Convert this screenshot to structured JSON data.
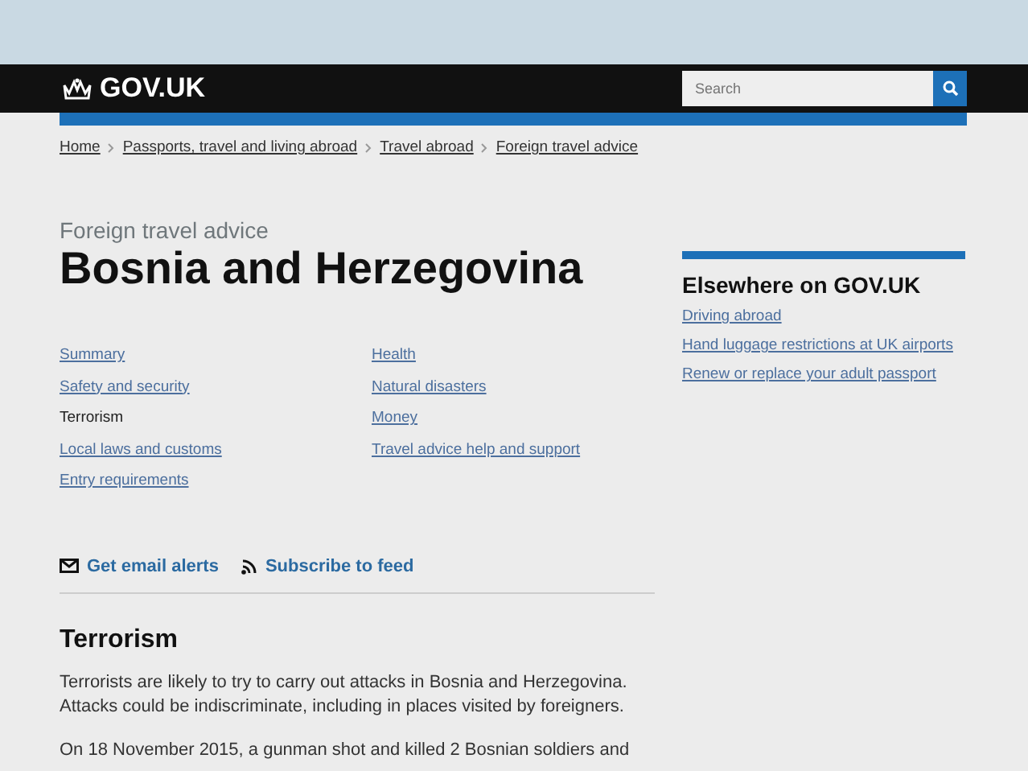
{
  "header": {
    "logo": "GOV.UK",
    "search": {
      "placeholder": "Search"
    }
  },
  "breadcrumbs": [
    "Home",
    "Passports, travel and living abroad",
    "Travel abroad",
    "Foreign travel advice"
  ],
  "caption": "Foreign travel advice",
  "title": "Bosnia and Herzegovina",
  "contents": [
    {
      "label": "Summary",
      "selected": false
    },
    {
      "label": "Safety and security",
      "selected": false
    },
    {
      "label": "Terrorism",
      "selected": true
    },
    {
      "label": "Local laws and customs",
      "selected": false
    },
    {
      "label": "Entry requirements",
      "selected": false
    },
    {
      "label": "Health",
      "selected": false
    },
    {
      "label": "Natural disasters",
      "selected": false
    },
    {
      "label": "Money",
      "selected": false
    },
    {
      "label": "Travel advice help and support",
      "selected": false
    }
  ],
  "subscriptions": [
    {
      "kind": "email",
      "label": "Get email alerts"
    },
    {
      "kind": "feed",
      "label": "Subscribe to feed"
    }
  ],
  "section": {
    "heading": "Terrorism",
    "paragraphs": [
      "Terrorists are likely to try to carry out attacks in Bosnia and Herzegovina. Attacks could be indiscriminate, including in places visited by foreigners.",
      "On 18 November 2015, a gunman shot and killed 2 Bosnian soldiers and"
    ]
  },
  "sidebar": {
    "heading": "Elsewhere on GOV.UK",
    "links": [
      "Driving abroad",
      "Hand luggage restrictions at UK airports",
      "Renew or replace your adult passport"
    ]
  }
}
